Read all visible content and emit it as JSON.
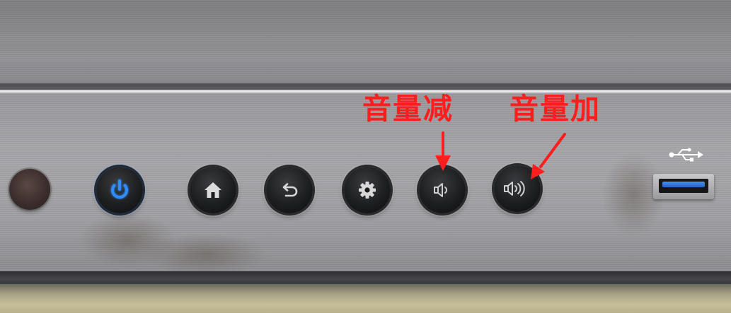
{
  "labels": {
    "volume_down": "音量减",
    "volume_up": "音量加"
  },
  "icons": {
    "power": "power-icon",
    "home": "home-icon",
    "back": "back-arrow-icon",
    "settings": "gear-icon",
    "volume_down": "speaker-low-icon",
    "volume_up": "speaker-high-icon",
    "usb": "usb-icon"
  },
  "colors": {
    "annotation": "#ff1e1e",
    "power_led": "#2f8dff",
    "usb_tongue": "#2f6fd6",
    "button_body": "#141416",
    "icon_gray": "#d8d8d8",
    "panel": "#a2a2a6"
  }
}
